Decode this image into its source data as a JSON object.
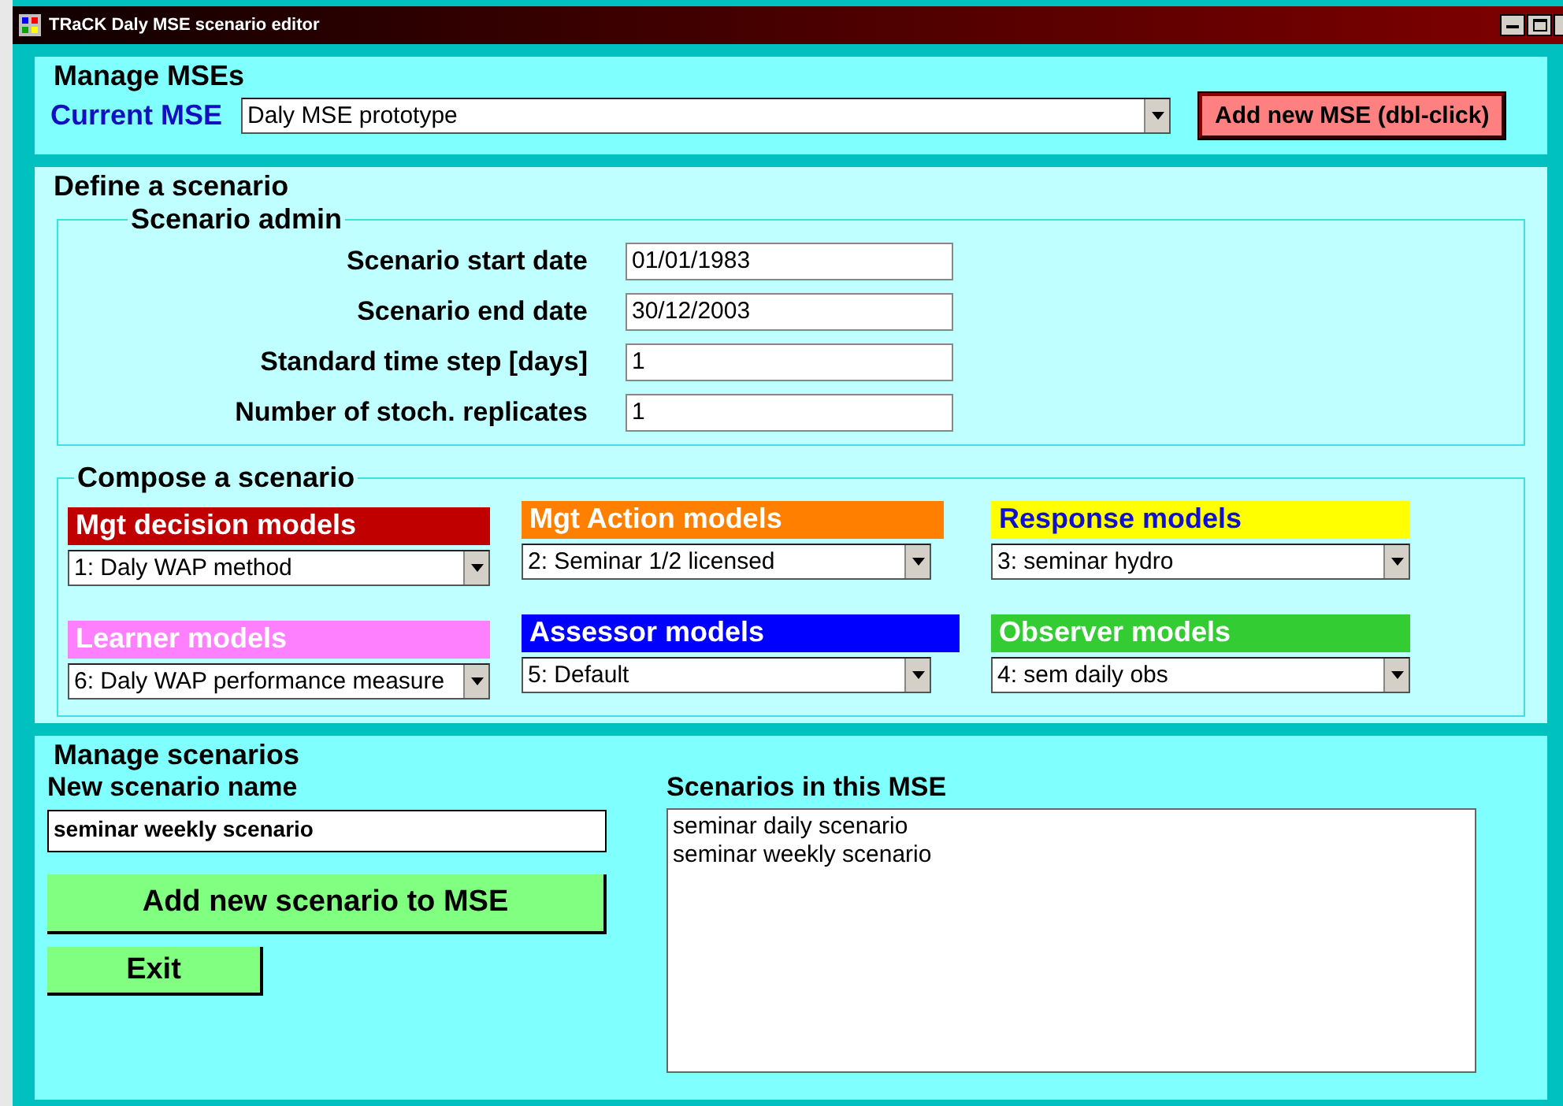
{
  "window": {
    "title": "TRaCK Daly MSE scenario editor"
  },
  "manage_mses": {
    "title": "Manage MSEs",
    "current_label": "Current MSE",
    "current_value": "Daly MSE prototype",
    "add_button": "Add new MSE (dbl-click)"
  },
  "define_scenario": {
    "title": "Define a scenario",
    "admin": {
      "title": "Scenario admin",
      "fields": [
        {
          "label": "Scenario start date",
          "value": "01/01/1983"
        },
        {
          "label": "Scenario end date",
          "value": "30/12/2003"
        },
        {
          "label": "Standard time step [days]",
          "value": "1"
        },
        {
          "label": "Number of stoch. replicates",
          "value": "1"
        }
      ]
    },
    "compose": {
      "title": "Compose a scenario",
      "models": [
        {
          "label": "Mgt decision models",
          "color": "#c00000",
          "value": "1: Daly WAP method"
        },
        {
          "label": "Mgt Action models",
          "color": "#ff8000",
          "value": "2: Seminar 1/2 licensed"
        },
        {
          "label": "Response models",
          "color": "#ffff00",
          "value": "3: seminar hydro"
        },
        {
          "label": "Learner models",
          "color": "#ff80ff",
          "value": "6: Daly WAP performance measure"
        },
        {
          "label": "Assessor models",
          "color": "#0000ff",
          "value": "5: Default"
        },
        {
          "label": "Observer models",
          "color": "#33cc33",
          "value": "4: sem daily obs"
        }
      ]
    }
  },
  "manage_scenarios": {
    "title": "Manage scenarios",
    "name_label": "New scenario name",
    "name_value": "seminar weekly scenario",
    "add_button": "Add new scenario to MSE",
    "exit_button": "Exit",
    "list_label": "Scenarios in this MSE",
    "list": [
      "seminar daily scenario",
      "seminar weekly scenario"
    ]
  }
}
